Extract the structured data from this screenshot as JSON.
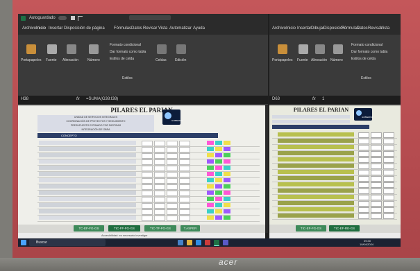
{
  "laptop": {
    "brand": "acer"
  },
  "left_window": {
    "autosave_label": "Autoguardado",
    "autosave_toggle": "off",
    "tabs": [
      "Archivo",
      "Inicio",
      "Insertar",
      "Disposición de página",
      "Fórmulas",
      "Datos",
      "Revisar",
      "Vista",
      "Automatizar",
      "Ayuda"
    ],
    "ribbon_groups": [
      "Portapapeles",
      "Fuente",
      "Alineación",
      "Número",
      "Formato condicional",
      "Dar formato como tabla",
      "Estilos de celda",
      "Celdas",
      "Edición",
      "Estilos"
    ],
    "name_box": "H38",
    "formula": "=SUMA(G38:I38)",
    "sheet": {
      "title": "PILARES EL PARIAN",
      "subtitle_lines": [
        "UNIDAD DE SERVICIOS INTEGRALES",
        "COORDINACIÓN DE PROYECTOS Y SEGUIMIENTO",
        "PRESUPUESTO ESTIMADO POR PARTIDAS",
        "INTEGRACIÓN DE OBRA"
      ],
      "header_label": "CONCEPTO",
      "logo_text": "GOBIERNO"
    },
    "sheet_tabs": [
      "TC-EF-FG-GS",
      "TIC-FF-FG-GS",
      "TIC-TF-FG-GS",
      "T.ASPER"
    ],
    "status": "Accesibilidad: es necesario investigar"
  },
  "right_window": {
    "tabs": [
      "Archivo",
      "Inicio",
      "Insertar",
      "Dibujar",
      "Disposición",
      "Fórmulas",
      "Datos",
      "Revisar",
      "Vista",
      "Automatizar",
      "Ayuda"
    ],
    "ribbon_groups": [
      "Portapapeles",
      "Fuente",
      "Alineación",
      "Número",
      "Formato condicional",
      "Dar formato como tabla",
      "Estilos de celda",
      "Estilos"
    ],
    "name_box": "D63",
    "formula": "1",
    "sheet": {
      "title": "PILARES EL PARIAN",
      "logo_text": "GOBIERNO"
    },
    "sheet_tabs": [
      "TIC-EF-FG-GS",
      "TIC-EF-RE-GS"
    ]
  },
  "taskbar": {
    "search_placeholder": "Buscar",
    "clock": "09:30",
    "date": "10/04/2024"
  }
}
